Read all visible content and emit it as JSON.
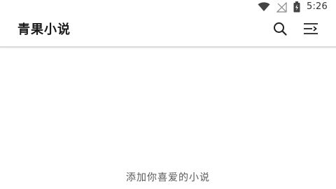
{
  "status_bar": {
    "time": "5:26",
    "icons": [
      "wifi-icon",
      "signal-icon",
      "battery-icon"
    ]
  },
  "app_bar": {
    "title": "青果小说",
    "actions": [
      "search-icon",
      "menu-icon"
    ]
  },
  "bookshelf": {
    "empty_hint": "添加你喜爱的小说"
  },
  "colors": {
    "background": "#ffffff",
    "title_text": "#1a1a1a",
    "hint_text": "#5a5a5a",
    "divider": "#dcdcdc"
  }
}
